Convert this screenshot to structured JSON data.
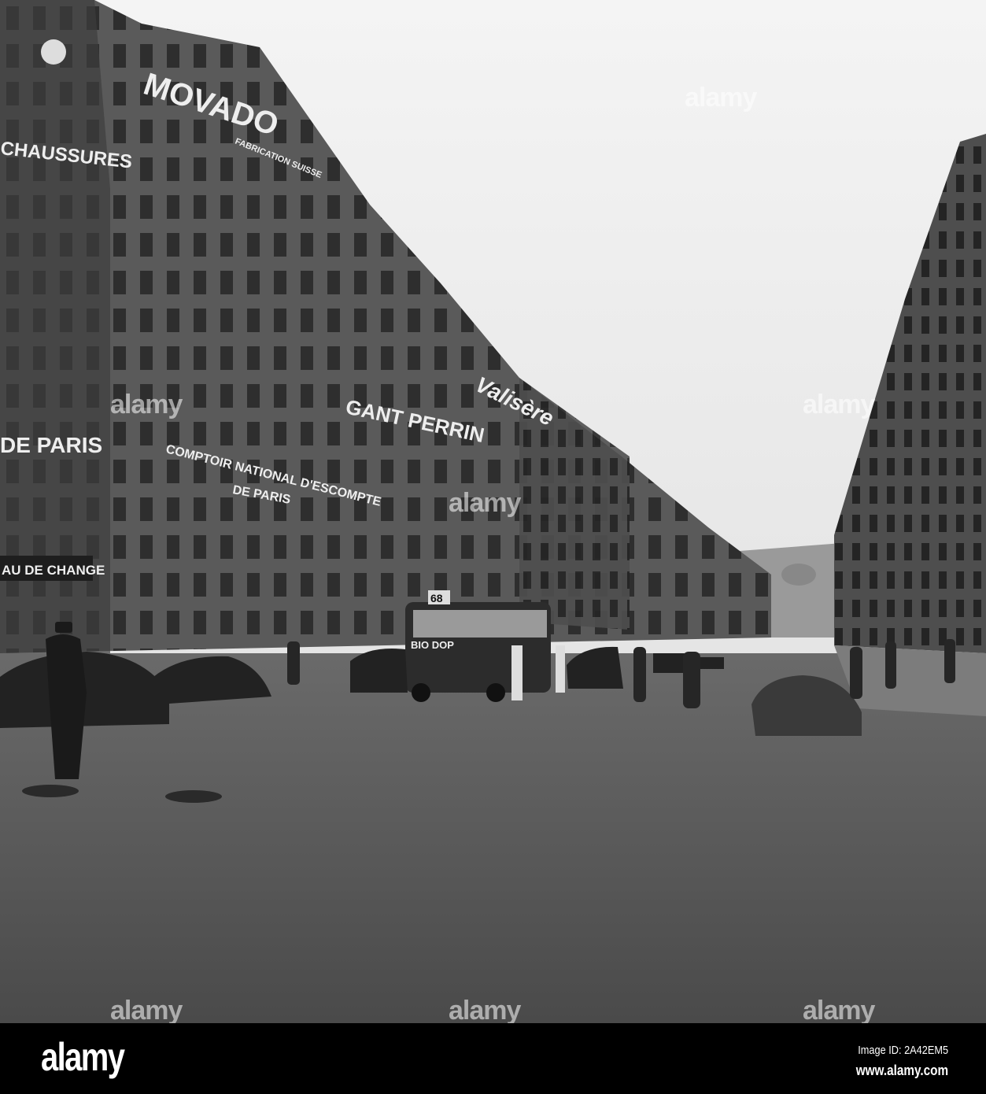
{
  "photo": {
    "signs": {
      "movado": "MOVADO",
      "fabrication": "FABRICATION SUISSE",
      "chaussures": "CHAUSSURES",
      "de_paris": "DE PARIS",
      "gant_perrin": "GANT PERRIN",
      "valisere": "Valisère",
      "comptoir": "COMPTOIR NATIONAL D'ESCOMPTE",
      "comptoir_line2": "DE PARIS",
      "change": "AU DE CHANGE",
      "bus_route": "68",
      "bus_ad": "BIO DOP"
    },
    "watermark": "alamy"
  },
  "footer": {
    "logo": "alamy",
    "image_id": "Image ID: 2A42EM5",
    "site": "www.alamy.com"
  }
}
